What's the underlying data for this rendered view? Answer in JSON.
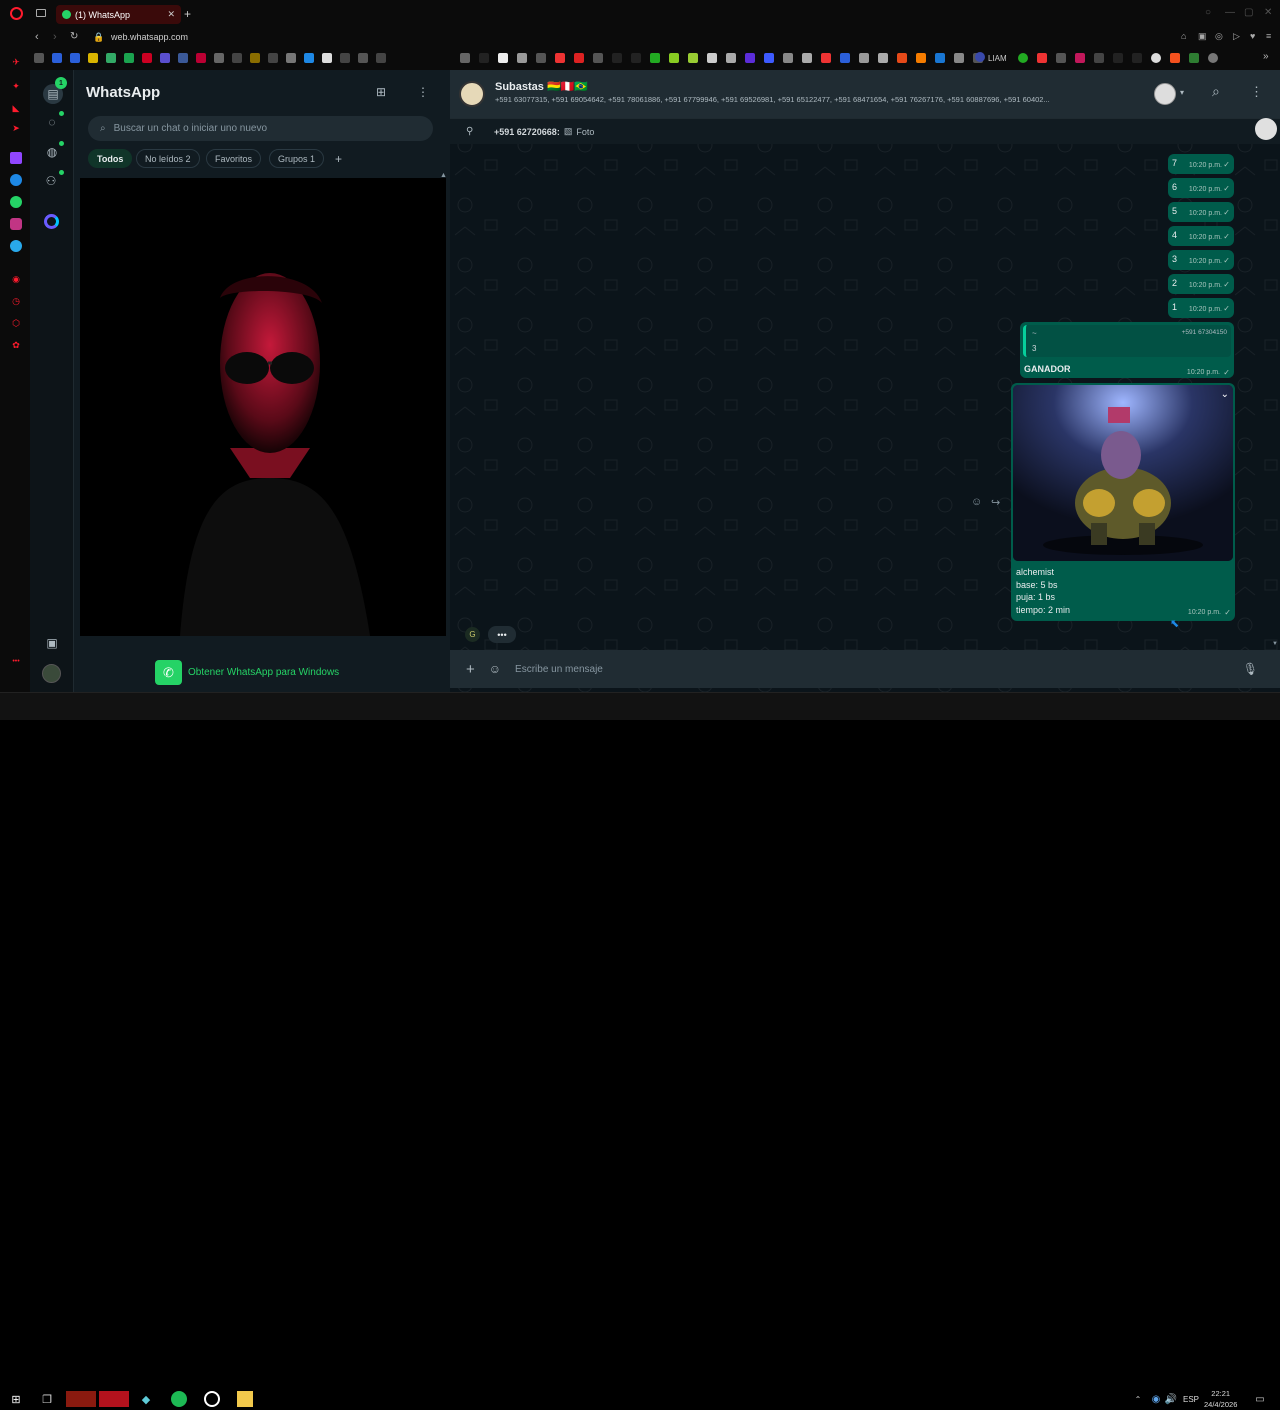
{
  "browser": {
    "tab_title": "(1) WhatsApp",
    "url": "web.whatsapp.com",
    "bookmark_label": "LIAM"
  },
  "wa": {
    "title": "WhatsApp",
    "rail_badge": "1",
    "search_placeholder": "Buscar un chat o iniciar uno nuevo",
    "filters": [
      {
        "label": "Todos"
      },
      {
        "label": "No leídos",
        "count": "2"
      },
      {
        "label": "Favoritos"
      },
      {
        "label": "Grupos",
        "count": "1"
      }
    ],
    "get_app": "Obtener WhatsApp para Windows"
  },
  "chat": {
    "name": "Subastas 🇧🇴🇵🇪🇧🇷",
    "participants": "+591 63077315, +591 69054642, +591 78061886, +591 67799946, +591 69526981, +591 65122477, +591 68471654, +591 76267176, +591 60887696, +591 60402...",
    "pinned_sender": "+591 62720668:",
    "pinned_text": "Foto",
    "countdown": [
      {
        "n": "7",
        "time": "10:20 p.m."
      },
      {
        "n": "6",
        "time": "10:20 p.m."
      },
      {
        "n": "5",
        "time": "10:20 p.m."
      },
      {
        "n": "4",
        "time": "10:20 p.m."
      },
      {
        "n": "3",
        "time": "10:20 p.m."
      },
      {
        "n": "2",
        "time": "10:20 p.m."
      },
      {
        "n": "1",
        "time": "10:20 p.m."
      }
    ],
    "reply": {
      "quoted_author": "~",
      "quoted_phone": "+591 67304150",
      "quoted_text": "3",
      "text": "GANADOR",
      "time": "10:20 p.m."
    },
    "image_msg": {
      "lines": [
        "alchemist",
        "base: 5 bs",
        "puja: 1 bs",
        "tiempo: 2 min"
      ],
      "time": "10:20 p.m."
    },
    "typing_avatar": "G",
    "composer_placeholder": "Escribe un mensaje"
  },
  "taskbar": {
    "lang": "ESP",
    "time": "22:21",
    "date": "24/4/2026"
  },
  "colors": {
    "accent": "#25d366",
    "outgoing": "#005c4b",
    "opera_red": "#ff1b2d"
  }
}
